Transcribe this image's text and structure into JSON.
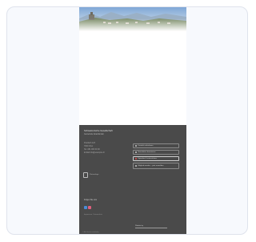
{
  "page": {
    "hero_image_alt": "mountain village landscape"
  },
  "footer": {
    "org_name": "Schweizerische Gesellschaft",
    "tagline": "Gemeinde Graubünden",
    "address_lines": [
      "Postfach 123",
      "7000 Chur",
      "Tel. 081 000 00 00",
      "E-Mail info@example.ch"
    ],
    "buttons": [
      {
        "label": "Kontakt aufnehmen",
        "icon": "mail-icon"
      },
      {
        "label": "Newsletter abonnieren",
        "icon": "newsletter-icon"
      },
      {
        "label": "Spenden & unterstützen",
        "icon": "heart-icon",
        "highlight": true
      },
      {
        "label": "Mitglied werden – jetzt anmelden",
        "icon": "member-icon"
      }
    ],
    "logo_text": "Partnerlogo",
    "follow_label": "Folgen Sie uns",
    "social": [
      {
        "name": "facebook",
        "icon": "facebook-icon",
        "color": "#4a8bd6"
      },
      {
        "name": "instagram",
        "icon": "instagram-icon",
        "color": "#e0607e"
      }
    ],
    "legal_text": "Impressum · Datenschutz",
    "credit_label": "Website by",
    "copyright": "© Alle Rechte vorbehalten"
  },
  "colors": {
    "footer_bg": "#4a4a4a",
    "card_bg": "#f7f9fd",
    "card_border": "#dfe3ec"
  }
}
